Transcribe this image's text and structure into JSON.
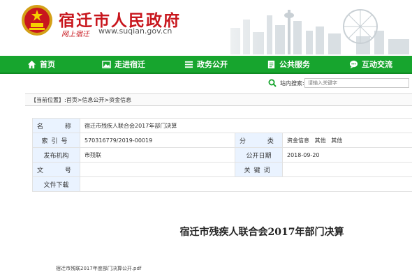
{
  "header": {
    "site_title": "宿迁市人民政府",
    "slogan": "网上宿迁",
    "url": "www.suqian.gov.cn"
  },
  "nav": {
    "items": [
      {
        "label": "首页",
        "icon": "home-icon"
      },
      {
        "label": "走进宿迁",
        "icon": "image-icon"
      },
      {
        "label": "政务公开",
        "icon": "list-icon"
      },
      {
        "label": "公共服务",
        "icon": "document-icon"
      },
      {
        "label": "互动交流",
        "icon": "chat-icon"
      }
    ]
  },
  "search": {
    "label": "站内搜索:",
    "placeholder": "请输入关键字"
  },
  "breadcrumb": {
    "prefix": "【当前位置】:",
    "items": [
      "首页",
      "信息公开",
      "资金信息"
    ],
    "separator": ">"
  },
  "info": {
    "name_label": "名 称",
    "name_value": "宿迁市残疾人联合会2017年部门决算",
    "index_label": "索引号",
    "index_value": "570316779/2019-00019",
    "category_label": "分 类",
    "category_value": "资金信息   其他   其他",
    "org_label": "发布机构",
    "org_value": "市残联",
    "date_label": "公开日期",
    "date_value": "2018-09-20",
    "docno_label": "文 号",
    "docno_value": "",
    "keywords_label": "关键词",
    "keywords_value": "",
    "download_label": "文件下载",
    "download_value": ""
  },
  "document": {
    "title": "宿迁市残疾人联合会2017年部门决算",
    "attachment": "宿迁市残联2017年度部门决算公开.pdf"
  },
  "colors": {
    "nav_green": "#17a52e",
    "title_red": "#c8161d",
    "label_blue": "#eaf3ff"
  }
}
